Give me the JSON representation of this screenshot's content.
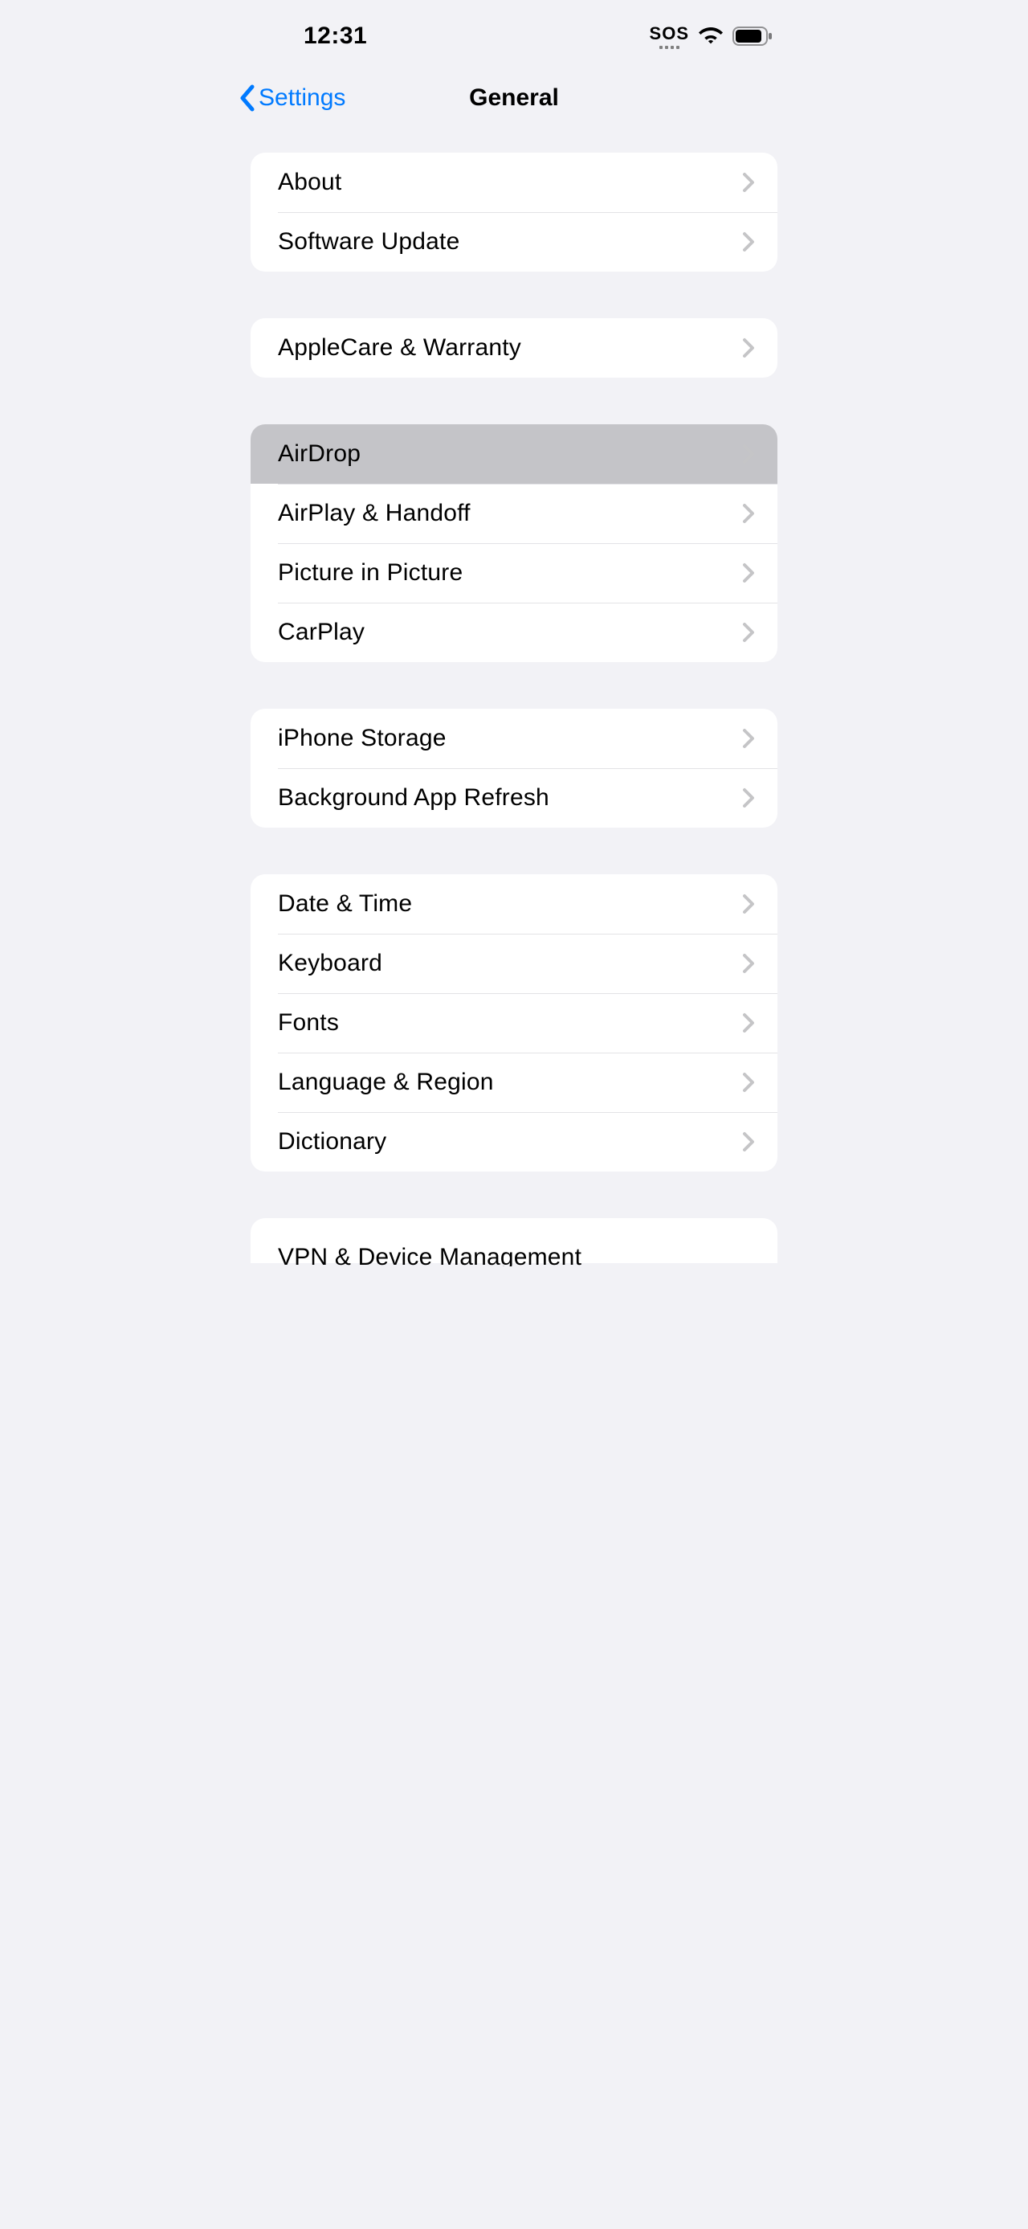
{
  "statusbar": {
    "time": "12:31",
    "sos": "SOS"
  },
  "navbar": {
    "back": "Settings",
    "title": "General"
  },
  "groups": [
    {
      "rows": [
        "About",
        "Software Update"
      ]
    },
    {
      "rows": [
        "AppleCare & Warranty"
      ]
    },
    {
      "rows": [
        "AirDrop",
        "AirPlay & Handoff",
        "Picture in Picture",
        "CarPlay"
      ],
      "pressed_index": 0
    },
    {
      "rows": [
        "iPhone Storage",
        "Background App Refresh"
      ]
    },
    {
      "rows": [
        "Date & Time",
        "Keyboard",
        "Fonts",
        "Language & Region",
        "Dictionary"
      ]
    },
    {
      "rows": [
        "VPN & Device Management"
      ],
      "cut": true
    }
  ]
}
